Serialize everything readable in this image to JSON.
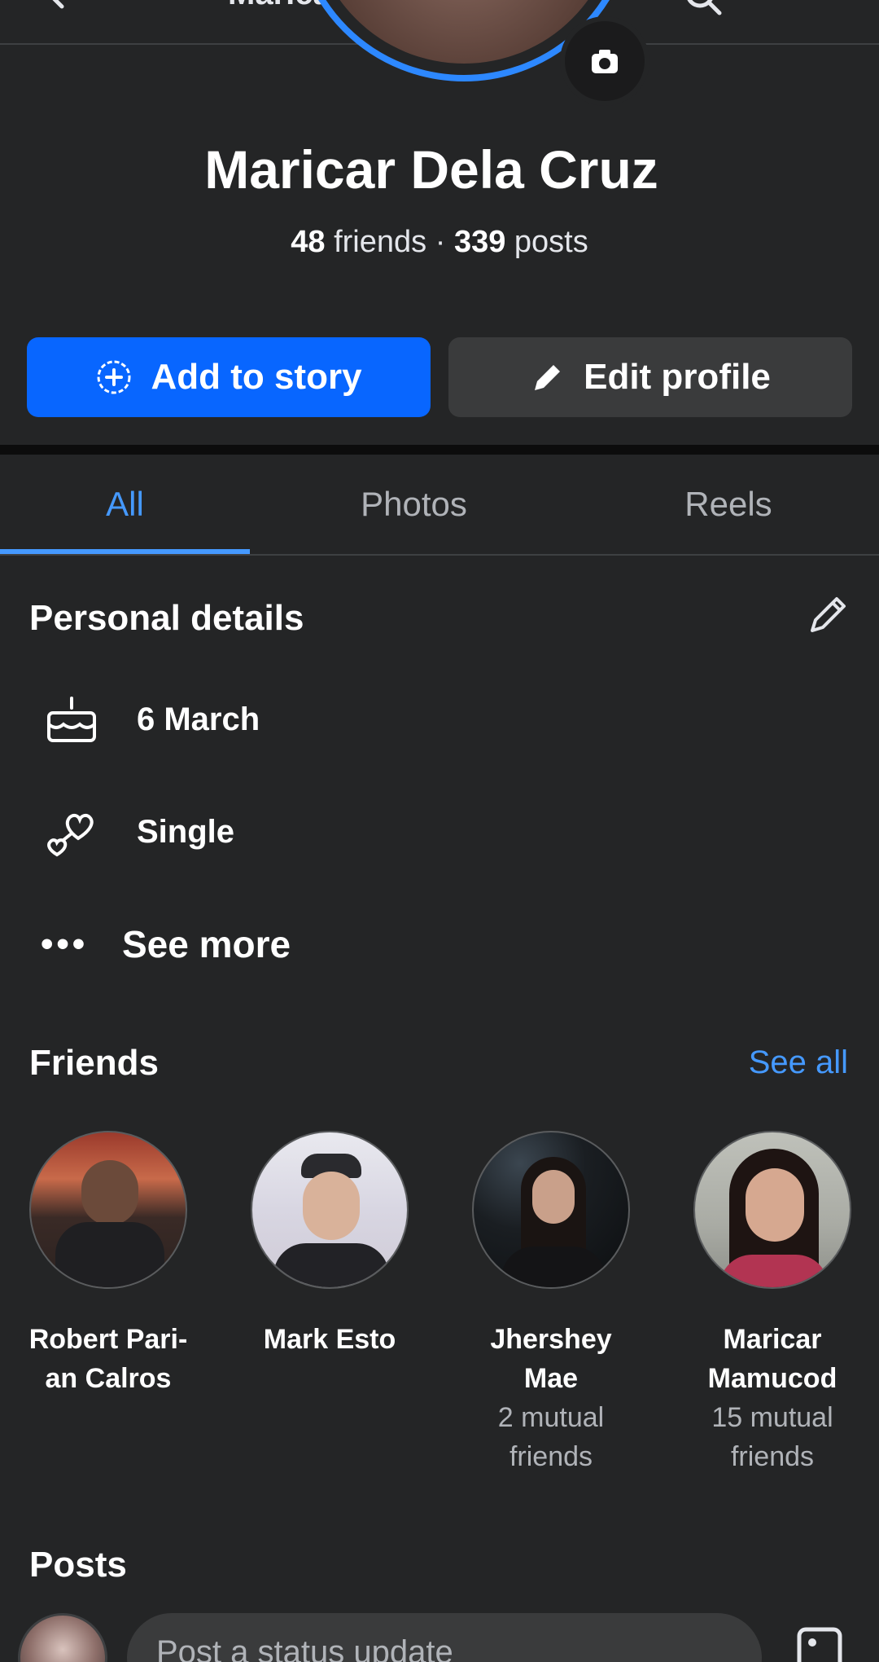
{
  "topbar": {
    "title": "Maricar Dela Cruz"
  },
  "profile": {
    "name": "Maricar Dela Cruz",
    "friends_count": "48",
    "friends_label": "friends",
    "separator": "·",
    "posts_count": "339",
    "posts_label": "posts"
  },
  "actions": {
    "add_story_label": "Add to story",
    "edit_profile_label": "Edit profile"
  },
  "tabs": [
    {
      "label": "All",
      "active": true
    },
    {
      "label": "Photos",
      "active": false
    },
    {
      "label": "Reels",
      "active": false
    }
  ],
  "personal_details": {
    "title": "Personal details",
    "items": [
      {
        "icon": "birthday-cake-icon",
        "text": "6 March"
      },
      {
        "icon": "relationship-hearts-icon",
        "text": "Single"
      }
    ],
    "see_more": "See more"
  },
  "friends": {
    "title": "Friends",
    "see_all": "See all",
    "items": [
      {
        "name_line1": "Robert Pari-",
        "name_line2": "an Calros",
        "mutual_line1": "",
        "mutual_line2": ""
      },
      {
        "name_line1": "Mark Esto",
        "name_line2": "",
        "mutual_line1": "",
        "mutual_line2": ""
      },
      {
        "name_line1": "Jhershey",
        "name_line2": "Mae",
        "mutual_line1": "2 mutual",
        "mutual_line2": "friends"
      },
      {
        "name_line1": "Maricar",
        "name_line2": "Mamucod",
        "mutual_line1": "15 mutual",
        "mutual_line2": "friends"
      }
    ]
  },
  "posts": {
    "title": "Posts",
    "composer_placeholder": "Post a status update"
  },
  "colors": {
    "background": "#242526",
    "accent": "#0866ff",
    "link": "#4599ff",
    "secondary_button": "#3a3b3c"
  }
}
